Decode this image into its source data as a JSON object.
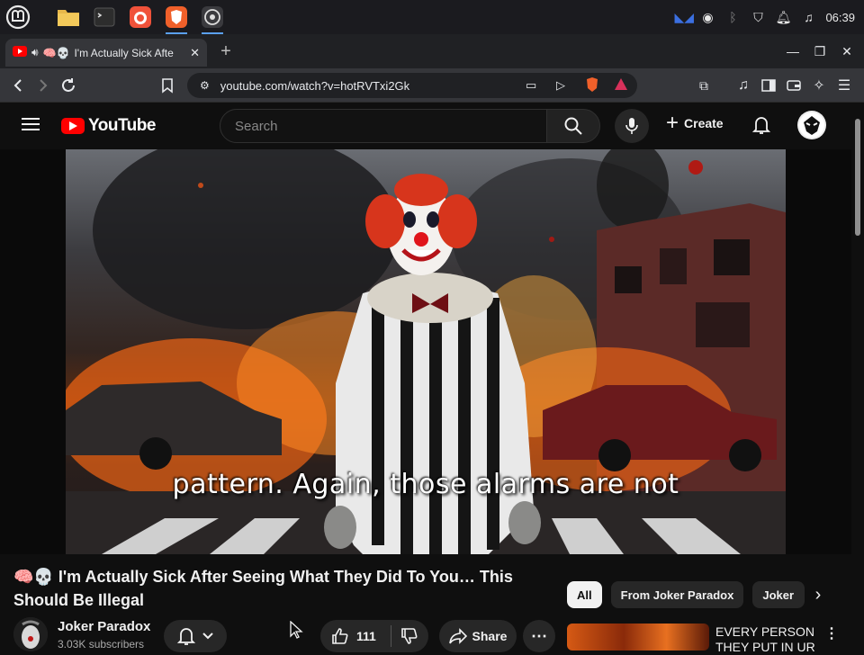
{
  "taskbar": {
    "apps": [
      "mint-menu",
      "files",
      "terminal",
      "firefox",
      "brave",
      "obs"
    ],
    "tray": {
      "time": "06:39"
    }
  },
  "browser": {
    "tab": {
      "emoji": "🧠💀",
      "title": "I'm Actually Sick Afte"
    },
    "url": "youtube.com/watch?v=hotRVTxi2Gk"
  },
  "youtube": {
    "logo_text": "YouTube",
    "search_placeholder": "Search",
    "create_label": "Create"
  },
  "video": {
    "caption": "pattern. Again, those alarms are not"
  },
  "details": {
    "title": "🧠💀 I'm Actually Sick After Seeing What They Did To You… This Should Be Illegal",
    "channel": "Joker Paradox",
    "subscribers": "3.03K subscribers",
    "likes": "111",
    "share_label": "Share"
  },
  "chips": [
    "All",
    "From Joker Paradox",
    "Joker"
  ],
  "recommended": {
    "title": "EVERY PERSON THEY PUT IN UR"
  },
  "colors": {
    "yt_red": "#ff0000",
    "background": "#0f0f0f",
    "chip_bg": "#272727"
  }
}
